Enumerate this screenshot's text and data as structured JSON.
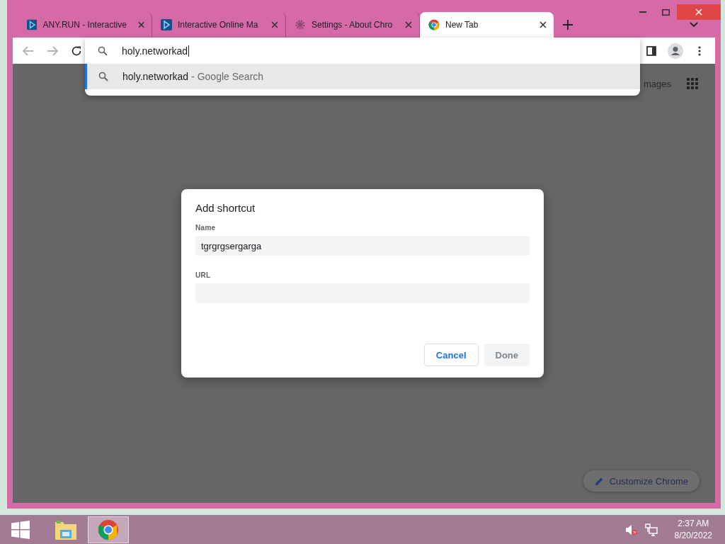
{
  "browser": {
    "tabs": [
      {
        "title": "ANY.RUN - Interactive",
        "kind": "anyrun",
        "selected": false
      },
      {
        "title": "Interactive Online Ma",
        "kind": "anyrun",
        "selected": false
      },
      {
        "title": "Settings - About Chro",
        "kind": "gear",
        "selected": false
      },
      {
        "title": "New Tab",
        "kind": "chrome",
        "selected": true
      }
    ],
    "omnibox": {
      "value": "holy.networkad",
      "suggestions": [
        {
          "text": "holy.networkad",
          "detail": "- Google Search",
          "selected": true
        }
      ]
    }
  },
  "page": {
    "header_link": "mages",
    "customize_button": "Customize Chrome"
  },
  "dialog": {
    "title": "Add shortcut",
    "fields": [
      {
        "label": "Name",
        "value": "tgrgrgsergarga"
      },
      {
        "label": "URL"
      }
    ],
    "buttons": [
      {
        "label": "Cancel",
        "disabled": false
      },
      {
        "label": "Done",
        "disabled": true
      }
    ]
  },
  "taskbar": {
    "apps": [
      {
        "kind": "explorer",
        "selected": false
      },
      {
        "kind": "chrome",
        "selected": true
      }
    ],
    "clock": {
      "time": "2:37 AM",
      "date": "8/20/2022"
    }
  }
}
